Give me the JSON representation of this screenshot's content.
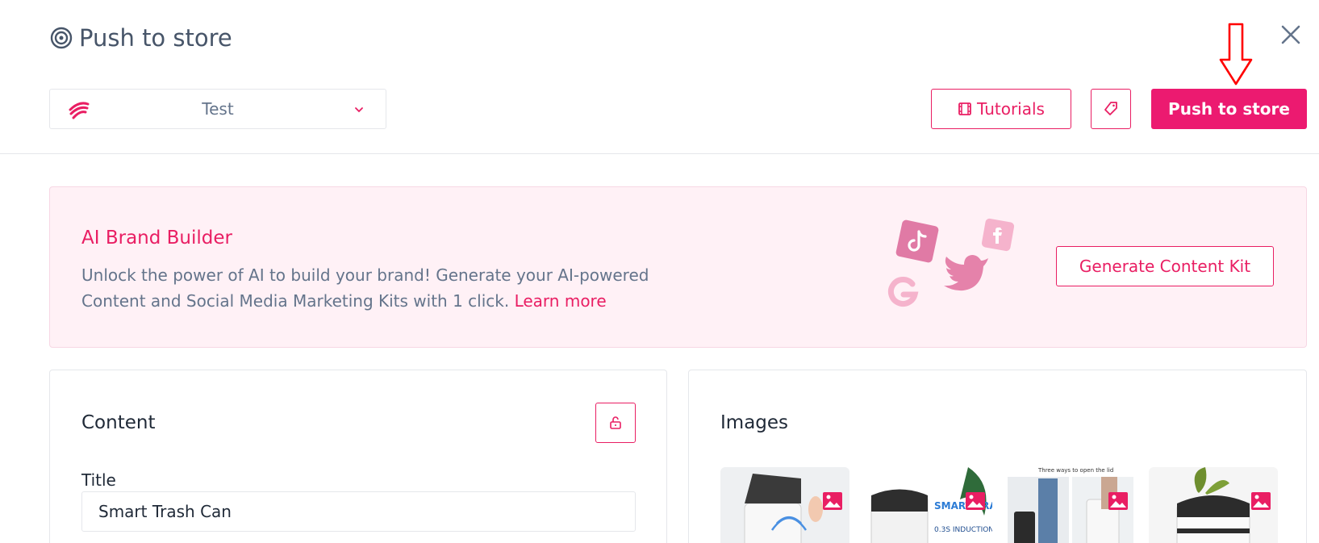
{
  "header": {
    "title": "Push to store",
    "store_name": "Test",
    "tutorials_label": "Tutorials",
    "push_label": "Push to store"
  },
  "banner": {
    "title": "AI Brand Builder",
    "text": "Unlock the power of AI to build your brand! Generate your AI-powered Content and Social Media Marketing Kits with 1 click.",
    "link": "Learn more",
    "button": "Generate Content Kit"
  },
  "content": {
    "heading": "Content",
    "title_label": "Title",
    "title_value": "Smart Trash Can"
  },
  "images": {
    "heading": "Images",
    "thumbs": [
      {
        "text": ""
      },
      {
        "text": "SMART TRASH CAN",
        "sub": "0.3S INDUCTION"
      },
      {
        "text": "Three ways to open the lid"
      },
      {
        "text": ""
      }
    ]
  },
  "colors": {
    "accent": "#e91e63",
    "banner_bg": "#fff1f6",
    "text_muted": "#64748b"
  },
  "icons": [
    "target-icon",
    "close-icon",
    "store-logo-icon",
    "chevron-down-icon",
    "film-icon",
    "tag-icon",
    "lock-icon",
    "image-icon",
    "tiktok-icon",
    "facebook-icon",
    "twitter-icon",
    "google-icon"
  ]
}
